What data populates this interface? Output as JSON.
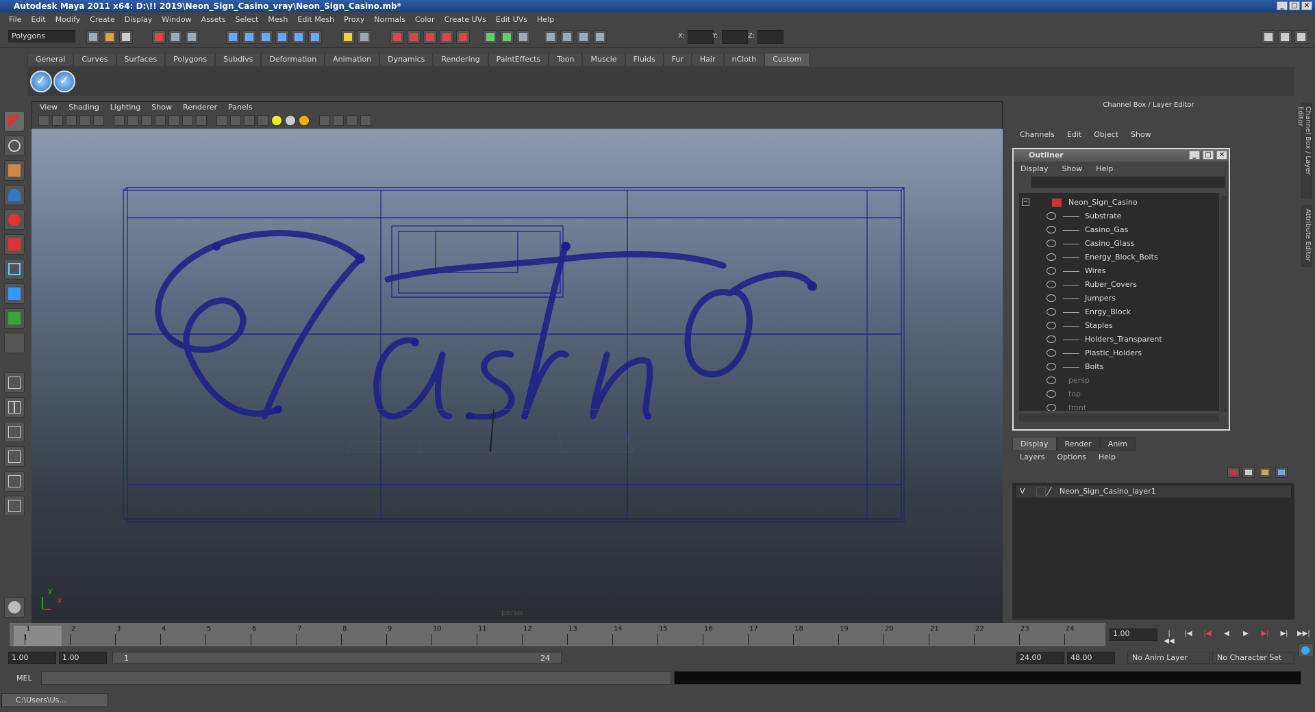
{
  "window": {
    "title": "Autodesk Maya 2011 x64: D:\\!! 2019\\Neon_Sign_Casino_vray\\Neon_Sign_Casino.mb*"
  },
  "menubar": [
    "File",
    "Edit",
    "Modify",
    "Create",
    "Display",
    "Window",
    "Assets",
    "Select",
    "Mesh",
    "Edit Mesh",
    "Proxy",
    "Normals",
    "Color",
    "Create UVs",
    "Edit UVs",
    "Help"
  ],
  "status_line": {
    "mode": "Polygons",
    "x_label": "X:",
    "y_label": "Y:",
    "z_label": "Z:"
  },
  "shelf": {
    "tabs": [
      "General",
      "Curves",
      "Surfaces",
      "Polygons",
      "Subdivs",
      "Deformation",
      "Animation",
      "Dynamics",
      "Rendering",
      "PaintEffects",
      "Toon",
      "Muscle",
      "Fluids",
      "Fur",
      "Hair",
      "nCloth",
      "Custom"
    ],
    "active_tab": "Custom"
  },
  "viewport": {
    "menu": [
      "View",
      "Shading",
      "Lighting",
      "Show",
      "Renderer",
      "Panels"
    ],
    "camera_label": "persp",
    "axis_x": "x",
    "axis_y": "y",
    "model_text": "Casino"
  },
  "channel_box": {
    "title": "Channel Box / Layer Editor",
    "menu": [
      "Channels",
      "Edit",
      "Object",
      "Show"
    ]
  },
  "outliner": {
    "title": "Outliner",
    "menu": [
      "Display",
      "Show",
      "Help"
    ],
    "root": "Neon_Sign_Casino",
    "children": [
      "Substrate",
      "Casino_Gas",
      "Casino_Glass",
      "Energy_Block_Bolts",
      "Wires",
      "Ruber_Covers",
      "Jumpers",
      "Enrgy_Block",
      "Staples",
      "Holders_Transparent",
      "Plastic_Holders",
      "Bolts"
    ],
    "cameras": [
      "persp",
      "top",
      "front"
    ]
  },
  "layer_editor": {
    "tabs": [
      "Display",
      "Render",
      "Anim"
    ],
    "active_tab": "Display",
    "menu": [
      "Layers",
      "Options",
      "Help"
    ],
    "layer": {
      "visible": "V",
      "name": "Neon_Sign_Casino_layer1"
    }
  },
  "side_tabs": [
    "Channel Box / Layer Editor",
    "Attribute Editor"
  ],
  "timeline": {
    "ticks": [
      "1",
      "2",
      "3",
      "4",
      "5",
      "6",
      "7",
      "8",
      "9",
      "10",
      "11",
      "12",
      "13",
      "14",
      "15",
      "16",
      "17",
      "18",
      "19",
      "20",
      "21",
      "22",
      "23",
      "24"
    ],
    "current_frame": "1",
    "current_field": "1.00"
  },
  "range": {
    "start": "1.00",
    "playback_start": "1.00",
    "slider_start": "1",
    "slider_end": "24",
    "playback_end": "24.00",
    "end": "48.00",
    "anim_layer": "No Anim Layer",
    "character_set": "No Character Set"
  },
  "command_line": {
    "label": "MEL"
  },
  "taskbar": {
    "item": "C:\\Users\\Us..."
  }
}
